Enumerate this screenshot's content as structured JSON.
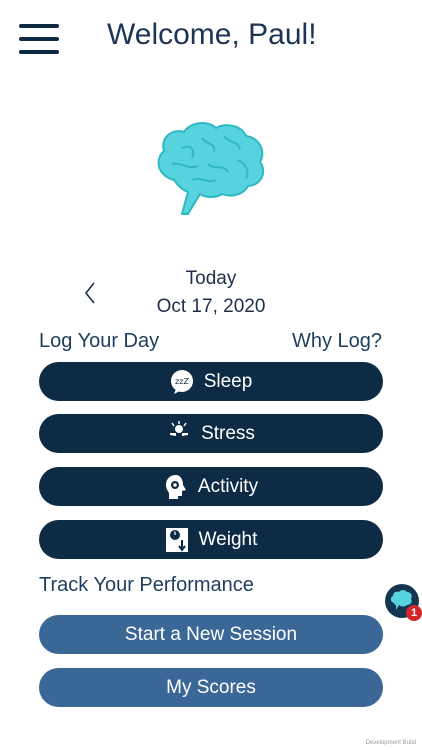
{
  "header": {
    "menu_icon": "hamburger-menu-icon",
    "welcome": "Welcome, Paul!"
  },
  "hero": {
    "icon": "brain-icon",
    "color": "#56d3dd"
  },
  "date_nav": {
    "prev_icon": "chevron-left-icon",
    "label": "Today",
    "date": "Oct 17, 2020"
  },
  "log_section": {
    "title": "Log Your Day",
    "why_link": "Why Log?",
    "buttons": [
      {
        "label": "Sleep",
        "icon": "sleep-zzz-icon"
      },
      {
        "label": "Stress",
        "icon": "stress-person-icon"
      },
      {
        "label": "Activity",
        "icon": "head-gear-icon"
      },
      {
        "label": "Weight",
        "icon": "scale-weight-icon"
      }
    ]
  },
  "performance": {
    "title": "Track Your Performance",
    "start_session": "Start a New Session",
    "my_scores": "My Scores"
  },
  "chat": {
    "icon": "brain-chat-icon",
    "badge": "1"
  },
  "footer": {
    "text": "Development Build"
  },
  "colors": {
    "dark_button": "#0d2b44",
    "blue_button": "#3b6796",
    "title": "#1c3557",
    "brain": "#56d3dd",
    "badge": "#d4252a"
  }
}
